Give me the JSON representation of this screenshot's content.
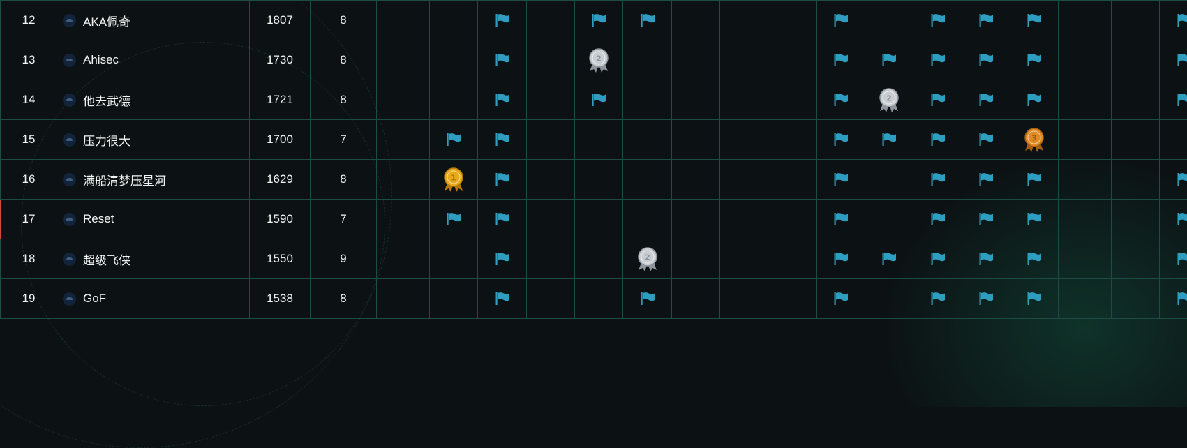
{
  "colors": {
    "background": "#0c1214",
    "grid": "#1b4d45",
    "flag": "#2f9dbf",
    "highlight_border": "#d7473c",
    "medal_gold": "#e8a91a",
    "medal_silver": "#c9cdd1",
    "medal_bronze": "#e08a22"
  },
  "scoreboard": {
    "rows": [
      {
        "rank": "12",
        "team": "AKA佩奇",
        "score": "1807",
        "solved": "8",
        "challenges": [
          "",
          "",
          "flag",
          "",
          "flag",
          "flag",
          "",
          "",
          "",
          "flag",
          "",
          "flag",
          "flag",
          "flag",
          "",
          "",
          "flag",
          ""
        ]
      },
      {
        "rank": "13",
        "team": "Ahisec",
        "score": "1730",
        "solved": "8",
        "challenges": [
          "",
          "",
          "flag",
          "",
          "medal-2",
          "",
          "",
          "",
          "",
          "flag",
          "flag",
          "flag",
          "flag",
          "flag",
          "",
          "",
          "flag",
          ""
        ]
      },
      {
        "rank": "14",
        "team": "他去武德",
        "score": "1721",
        "solved": "8",
        "challenges": [
          "",
          "",
          "flag",
          "",
          "flag",
          "",
          "",
          "",
          "",
          "flag",
          "medal-2",
          "flag",
          "flag",
          "flag",
          "",
          "",
          "flag",
          ""
        ]
      },
      {
        "rank": "15",
        "team": "压力很大",
        "score": "1700",
        "solved": "7",
        "challenges": [
          "",
          "flag",
          "flag",
          "",
          "",
          "",
          "",
          "",
          "",
          "flag",
          "flag",
          "flag",
          "flag",
          "medal-3",
          "",
          "",
          "",
          ""
        ]
      },
      {
        "rank": "16",
        "team": "满船清梦压星河",
        "score": "1629",
        "solved": "8",
        "challenges": [
          "",
          "medal-1",
          "flag",
          "",
          "",
          "",
          "",
          "",
          "",
          "flag",
          "",
          "flag",
          "flag",
          "flag",
          "",
          "",
          "flag",
          ""
        ]
      },
      {
        "rank": "17",
        "team": "Reset",
        "score": "1590",
        "solved": "7",
        "challenges": [
          "",
          "flag",
          "flag",
          "",
          "",
          "",
          "",
          "",
          "",
          "flag",
          "",
          "flag",
          "flag",
          "flag",
          "",
          "",
          "flag",
          ""
        ],
        "highlight": true
      },
      {
        "rank": "18",
        "team": "超级飞侠",
        "score": "1550",
        "solved": "9",
        "challenges": [
          "",
          "",
          "flag",
          "",
          "",
          "medal-2",
          "",
          "",
          "",
          "flag",
          "flag",
          "flag",
          "flag",
          "flag",
          "",
          "",
          "flag",
          ""
        ]
      },
      {
        "rank": "19",
        "team": "GoF",
        "score": "1538",
        "solved": "8",
        "challenges": [
          "",
          "",
          "flag",
          "",
          "",
          "flag",
          "",
          "",
          "",
          "flag",
          "",
          "flag",
          "flag",
          "flag",
          "",
          "",
          "flag",
          ""
        ]
      }
    ]
  }
}
